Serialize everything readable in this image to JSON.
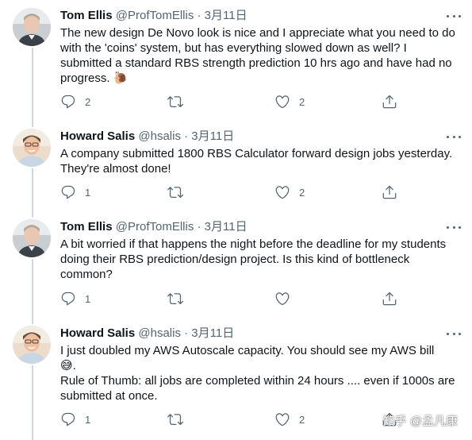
{
  "tweets": [
    {
      "name": "Tom Ellis",
      "handle": "@ProfTomEllis",
      "separator": "·",
      "date": "3月11日",
      "text_lines": [
        "The new design De Novo look is nice and I appreciate what you need to do with the 'coins' system, but has everything slowed down as well? I submitted a standard RBS strength prediction 10 hrs ago and have had no progress. 🐌"
      ],
      "replies": "2",
      "retweets": "",
      "likes": "2",
      "avatar": "tom-ellis-avatar"
    },
    {
      "name": "Howard Salis",
      "handle": "@hsalis",
      "separator": "·",
      "date": "3月11日",
      "text_lines": [
        "A company submitted 1800 RBS Calculator forward design jobs yesterday. They're almost done!"
      ],
      "replies": "1",
      "retweets": "",
      "likes": "2",
      "avatar": "howard-salis-avatar"
    },
    {
      "name": "Tom Ellis",
      "handle": "@ProfTomEllis",
      "separator": "·",
      "date": "3月11日",
      "text_lines": [
        "A bit worried if that happens the night before the deadline for my students doing their RBS prediction/design project. Is this kind of bottleneck common?"
      ],
      "replies": "1",
      "retweets": "",
      "likes": "",
      "avatar": "tom-ellis-avatar"
    },
    {
      "name": "Howard Salis",
      "handle": "@hsalis",
      "separator": "·",
      "date": "3月11日",
      "text_lines": [
        "I just doubled my AWS Autoscale capacity. You should see my AWS bill 😅.",
        "Rule of Thumb: all jobs are completed within 24 hours .... even if 1000s are submitted at once."
      ],
      "replies": "1",
      "retweets": "",
      "likes": "2",
      "avatar": "howard-salis-avatar"
    }
  ],
  "icons": {
    "reply": "reply-icon",
    "retweet": "retweet-icon",
    "like": "heart-icon",
    "share": "share-icon",
    "more": "more-icon"
  },
  "colors": {
    "icon_gray": "#536471",
    "text": "#0f1419",
    "thread_line": "#cfd9de"
  },
  "watermark": "知乎 @孟凡康"
}
